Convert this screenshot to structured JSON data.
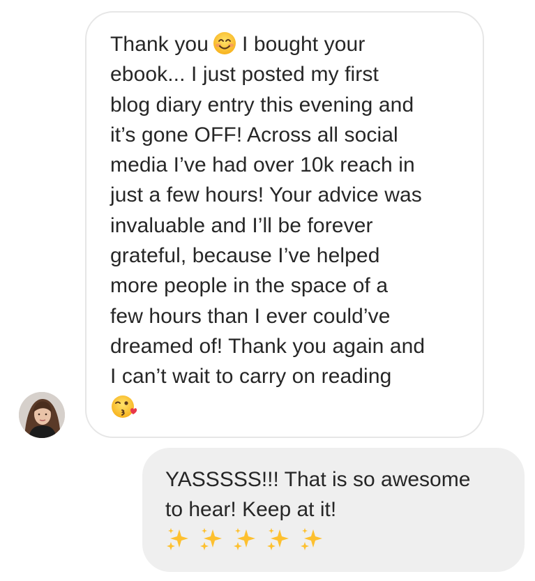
{
  "conversation": {
    "incoming_message": {
      "text_before_emoji": "Thank you",
      "first_emoji": "smiling-face-emoji",
      "text_after_emoji": "I bought your\nebook... I just posted my first\nblog diary entry this evening and\nit’s gone OFF! Across all social\nmedia I’ve had over 10k reach in\njust a few hours! Your advice was\ninvaluable and I’ll be forever\ngrateful, because I’ve helped\nmore people in the space of a\nfew hours than I ever could’ve\ndreamed of! Thank you again and\nI can’t wait to carry on reading",
      "last_emoji": "face-blowing-kiss-emoji"
    },
    "outgoing_message": {
      "text": "YASSSSS!!! That is so awesome\nto hear! Keep at it!",
      "emoji": "sparkles-emoji",
      "emoji_count": 5
    }
  },
  "colors": {
    "text": "#262626",
    "incoming_border": "#e6e6e6",
    "outgoing_background": "#efefef",
    "emoji_yellow": "#fdc02f",
    "heart_red": "#e8374a"
  }
}
